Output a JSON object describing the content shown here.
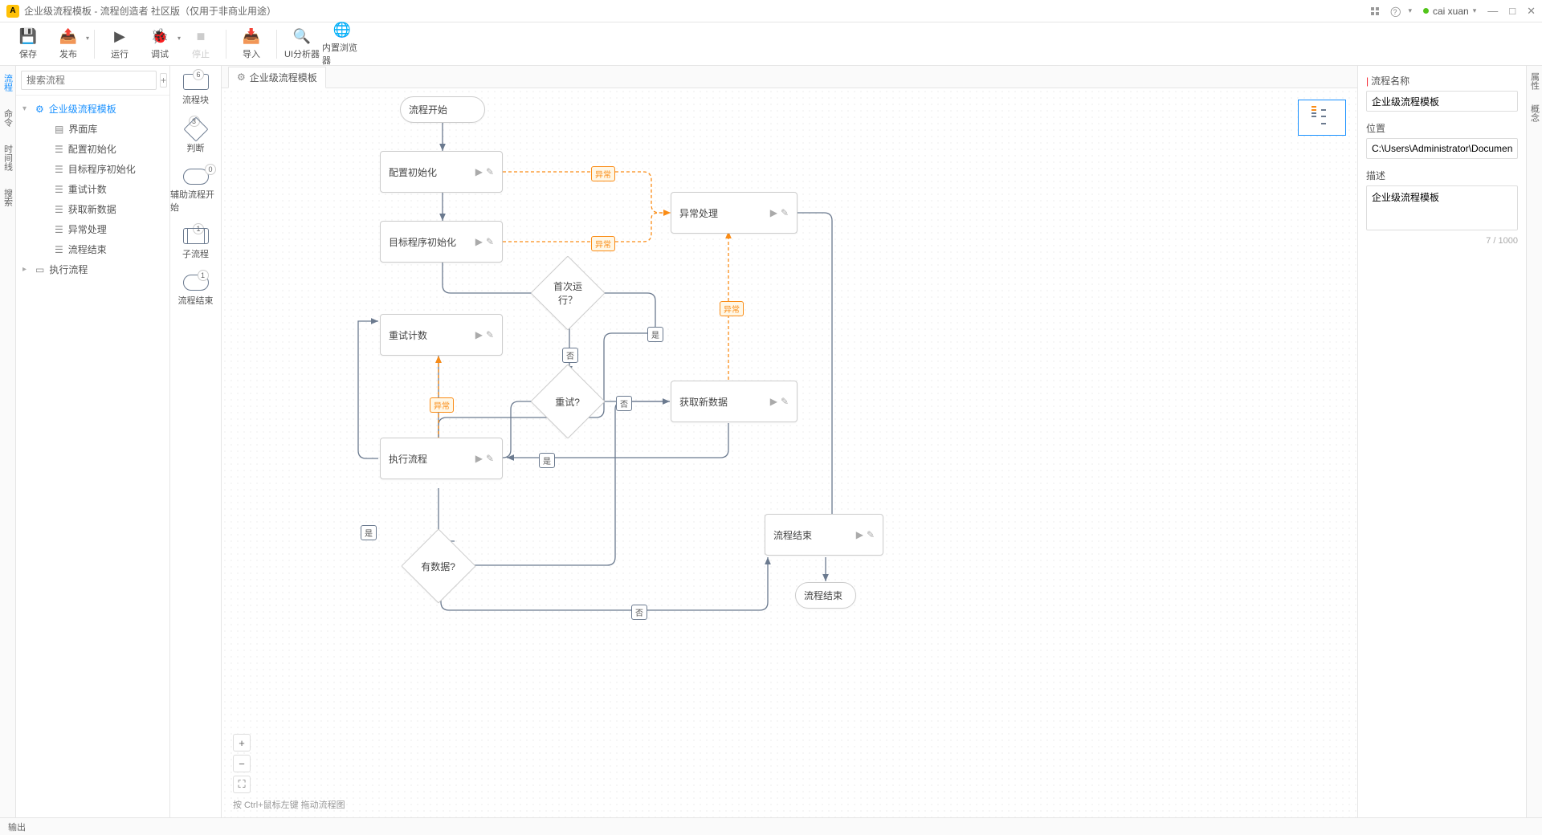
{
  "titlebar": {
    "app_badge": "A",
    "title": "企业级流程模板 - 流程创造者 社区版（仅用于非商业用途）",
    "help_label": "?",
    "user": "cai xuan"
  },
  "toolbar": {
    "save": "保存",
    "publish": "发布",
    "run": "运行",
    "debug": "调试",
    "stop": "停止",
    "import": "导入",
    "ui_analyzer": "UI分析器",
    "builtin_browser": "内置浏览器"
  },
  "left_rail": {
    "process": "流程",
    "command": "命令",
    "timeline": "时间线",
    "search": "搜索"
  },
  "sidebar": {
    "search_placeholder": "搜索流程",
    "root": "企业级流程模板",
    "children": [
      "界面库",
      "配置初始化",
      "目标程序初始化",
      "重试计数",
      "获取新数据",
      "异常处理",
      "流程结束"
    ],
    "exec": "执行流程"
  },
  "palette": {
    "items": [
      {
        "label": "流程块",
        "badge": "6",
        "shape": "rect"
      },
      {
        "label": "判断",
        "badge": "3",
        "shape": "diamond"
      },
      {
        "label": "辅助流程开始",
        "badge": "0",
        "shape": "stadium"
      },
      {
        "label": "子流程",
        "badge": "1",
        "shape": "subproc"
      },
      {
        "label": "流程结束",
        "badge": "1",
        "shape": "stadium"
      }
    ]
  },
  "tab": {
    "label": "企业级流程模板"
  },
  "nodes": {
    "start": "流程开始",
    "config": "配置初始化",
    "target": "目标程序初始化",
    "first_run": "首次运行？",
    "retry_count": "重试计数",
    "retry": "重试?",
    "exec": "执行流程",
    "has_data": "有数据?",
    "fetch": "获取新数据",
    "exception": "异常处理",
    "end1": "流程结束",
    "end2": "流程结束"
  },
  "edge_labels": {
    "exception": "异常",
    "yes": "是",
    "no": "否"
  },
  "zoom": {
    "in": "+",
    "out": "−",
    "fit": "⛶"
  },
  "hint": "按 Ctrl+鼠标左键 拖动流程图",
  "right_rail": {
    "props": "属性",
    "concept": "概念"
  },
  "props": {
    "name_label": "流程名称",
    "name_value": "企业级流程模板",
    "loc_label": "位置",
    "loc_value": "C:\\Users\\Administrator\\Document",
    "desc_label": "描述",
    "desc_value": "企业级流程模板",
    "char_count": "7 / 1000"
  },
  "statusbar": {
    "output": "输出"
  }
}
